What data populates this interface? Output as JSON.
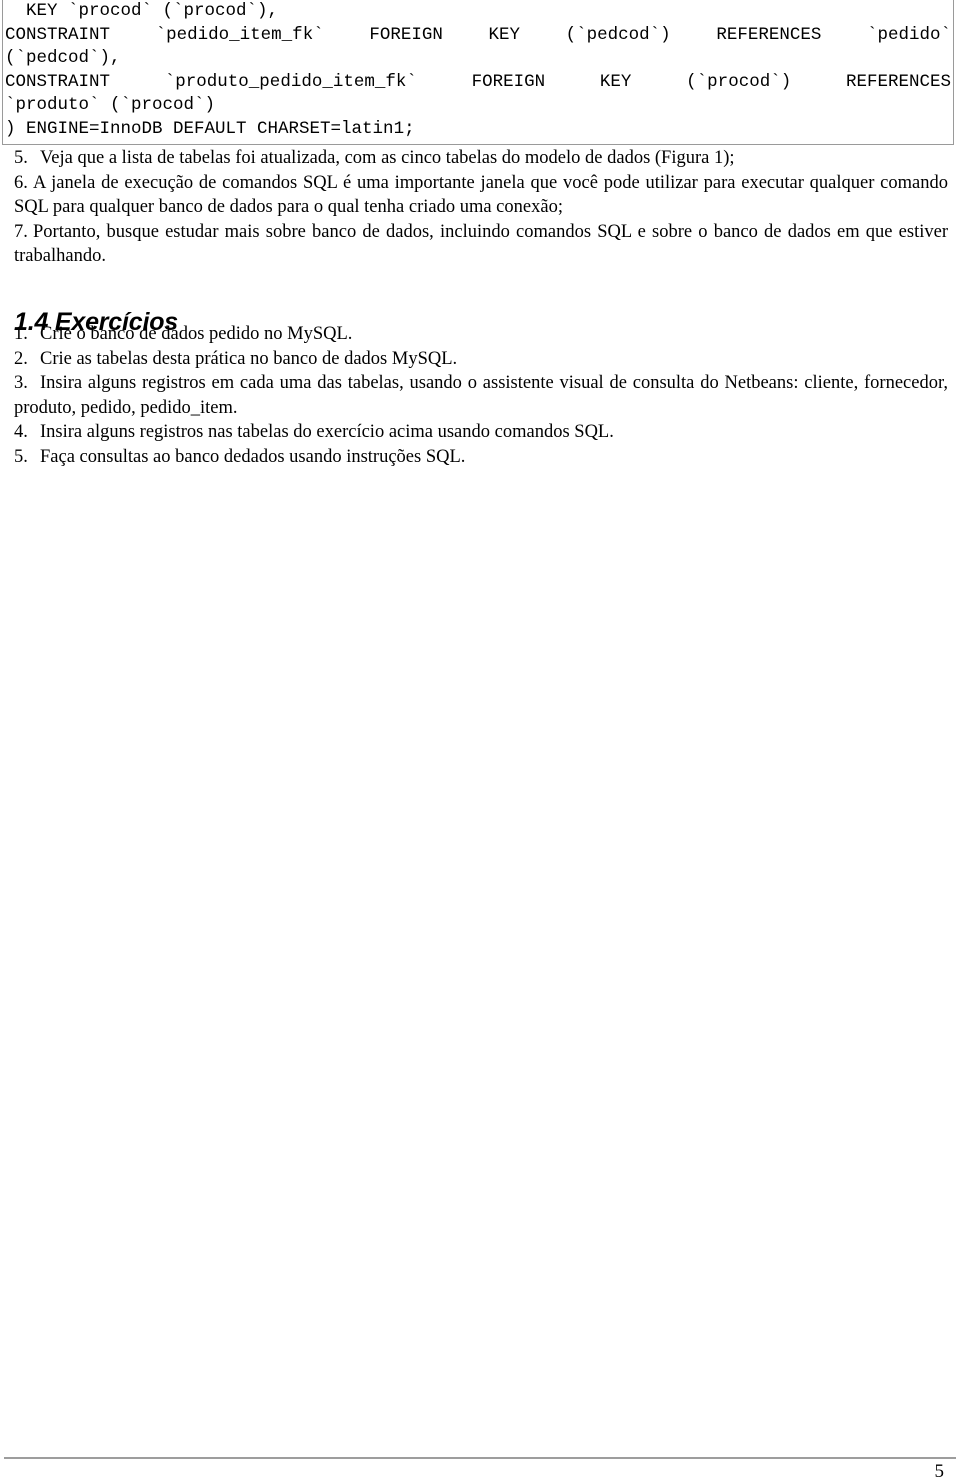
{
  "document": {
    "page_number": "5",
    "code_block": {
      "name": "sql-create-table-snippet",
      "lines": [
        {
          "text": "  KEY `procod` (`procod`),",
          "justify": false
        },
        {
          "text": "  CONSTRAINT `pedido_item_fk` FOREIGN KEY (`pedcod`) REFERENCES `pedido`",
          "justify": true
        },
        {
          "text": "(`pedcod`),",
          "justify": false
        },
        {
          "text": "  CONSTRAINT `produto_pedido_item_fk` FOREIGN KEY (`procod`) REFERENCES",
          "justify": true
        },
        {
          "text": "`produto` (`procod`)",
          "justify": false
        },
        {
          "text": ") ENGINE=InnoDB DEFAULT CHARSET=latin1;",
          "justify": false
        }
      ]
    },
    "body_items": [
      {
        "number": "5.",
        "text": "Veja que a lista de tabelas foi atualizada, com as cinco tabelas do modelo de dados (Figura 1);",
        "gap": "wide"
      },
      {
        "number": "6.",
        "text": "A janela de execução de comandos SQL é uma importante janela que você pode utilizar para executar qualquer comando SQL para qualquer banco de dados para o qual tenha criado uma conexão;",
        "gap": "thin"
      },
      {
        "number": "7.",
        "text": "Portanto, busque estudar mais sobre banco de dados, incluindo comandos SQL e sobre o banco de dados em que estiver trabalhando.",
        "gap": "wide"
      }
    ],
    "heading": "1.4 Exercícios",
    "exercises": [
      {
        "number": "1.",
        "text": "Crie o banco de dados pedido no MySQL."
      },
      {
        "number": "2.",
        "text": "Crie as tabelas desta prática no banco de dados MySQL."
      },
      {
        "number": "3.",
        "text": "Insira alguns registros em cada uma das tabelas, usando o assistente visual de consulta do Netbeans: cliente, fornecedor, produto, pedido, pedido_item."
      },
      {
        "number": "4.",
        "text": "Insira alguns registros nas tabelas do exercício acima usando comandos SQL."
      },
      {
        "number": "5.",
        "text": "Faça consultas ao banco dedados usando instruções SQL."
      }
    ]
  },
  "colors": {
    "text": "#000000",
    "code_border": "#9a9a9a",
    "footer_rule": "#9d9d9d",
    "background": "#ffffff"
  }
}
